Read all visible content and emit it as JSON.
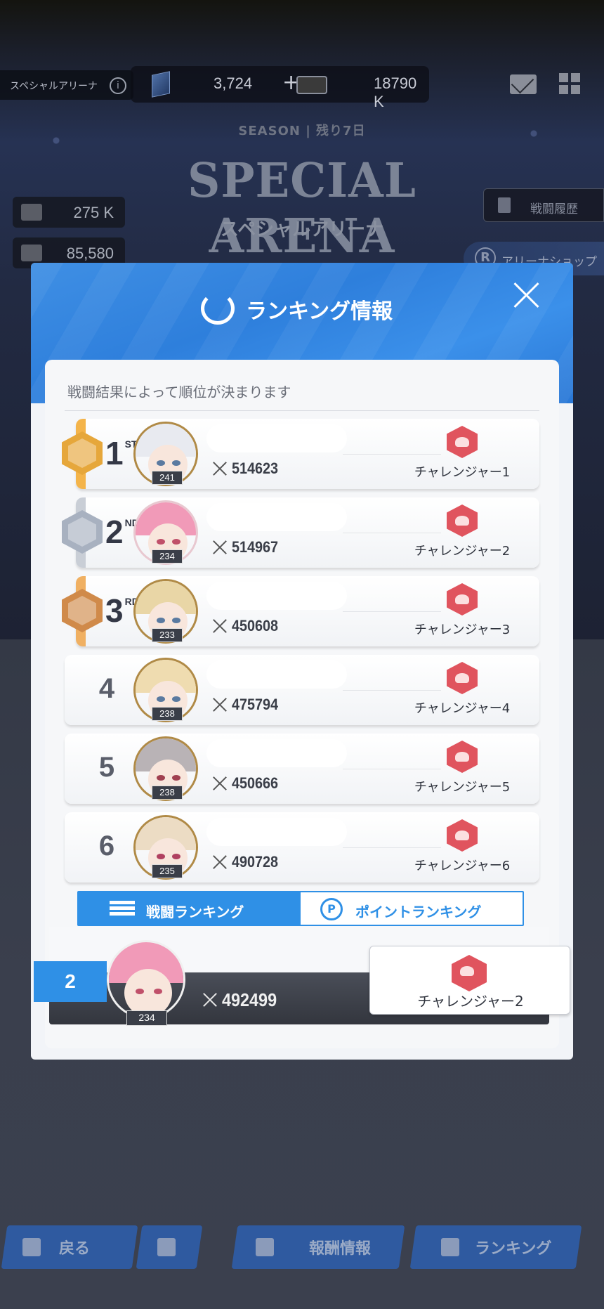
{
  "top_bar": {
    "arena_label": "スペシャルアリーナ",
    "info_icon": "info-icon",
    "crystal_value": "3,724",
    "plus": "+",
    "ticket_value": "18790 K"
  },
  "season": "SEASON | 残り7日",
  "arena_title": "SPECIAL ARENA",
  "arena_subtitle": "スペシャルアリーナ",
  "side_resources": [
    "275 K",
    "85,580"
  ],
  "battle_history_label": "戦闘履歴",
  "arena_shop_label": "アリーナショップ",
  "modal": {
    "title": "ランキング情報",
    "description": "戦闘結果によって順位が決まります",
    "rows": [
      {
        "rank": "1",
        "suffix": "ST",
        "level": "241",
        "power": "514623",
        "tier": "チャレンジャー1"
      },
      {
        "rank": "2",
        "suffix": "ND",
        "level": "234",
        "power": "514967",
        "tier": "チャレンジャー2"
      },
      {
        "rank": "3",
        "suffix": "RD",
        "level": "233",
        "power": "450608",
        "tier": "チャレンジャー3"
      },
      {
        "rank": "4",
        "suffix": "",
        "level": "238",
        "power": "475794",
        "tier": "チャレンジャー4"
      },
      {
        "rank": "5",
        "suffix": "",
        "level": "238",
        "power": "450666",
        "tier": "チャレンジャー5"
      },
      {
        "rank": "6",
        "suffix": "",
        "level": "235",
        "power": "490728",
        "tier": "チャレンジャー6"
      }
    ],
    "tabs": {
      "battle": "戦闘ランキング",
      "point": "ポイントランキング"
    },
    "my_rank": {
      "rank": "2",
      "level": "234",
      "power": "492499",
      "tier": "チャレンジャー2"
    }
  },
  "bottom_nav": {
    "back": "戻る",
    "reward": "報酬情報",
    "ranking": "ランキング"
  },
  "colors": {
    "accent": "#2f90e6",
    "gold": "#e6a73b",
    "silver": "#a8b1c0",
    "bronze": "#d08a4a",
    "tier": "#e0545e"
  }
}
